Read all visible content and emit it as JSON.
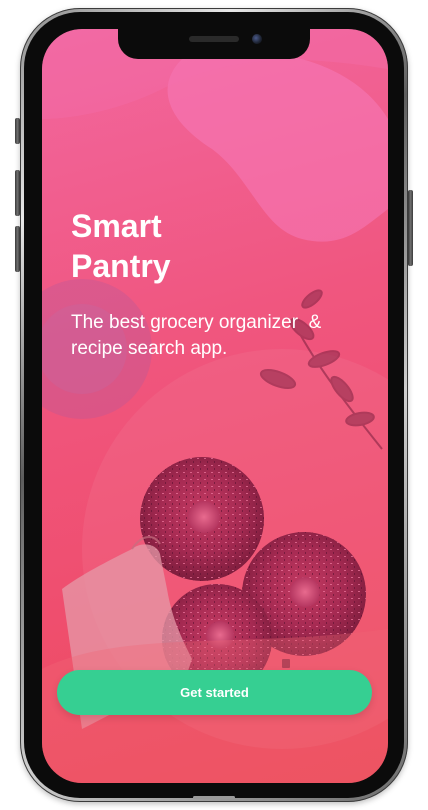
{
  "app": {
    "title_line1": "Smart",
    "title_line2": "Pantry",
    "tagline": "The best grocery organizer  &\nrecipe search app."
  },
  "actions": {
    "get_started_label": "Get started"
  },
  "colors": {
    "gradient_top": "#f2679f",
    "gradient_bottom": "#ec4a57",
    "button": "#36cf92",
    "text": "#ffffff"
  },
  "icons": {
    "background_image": "donuts-photo",
    "camera": "front-camera-icon"
  }
}
